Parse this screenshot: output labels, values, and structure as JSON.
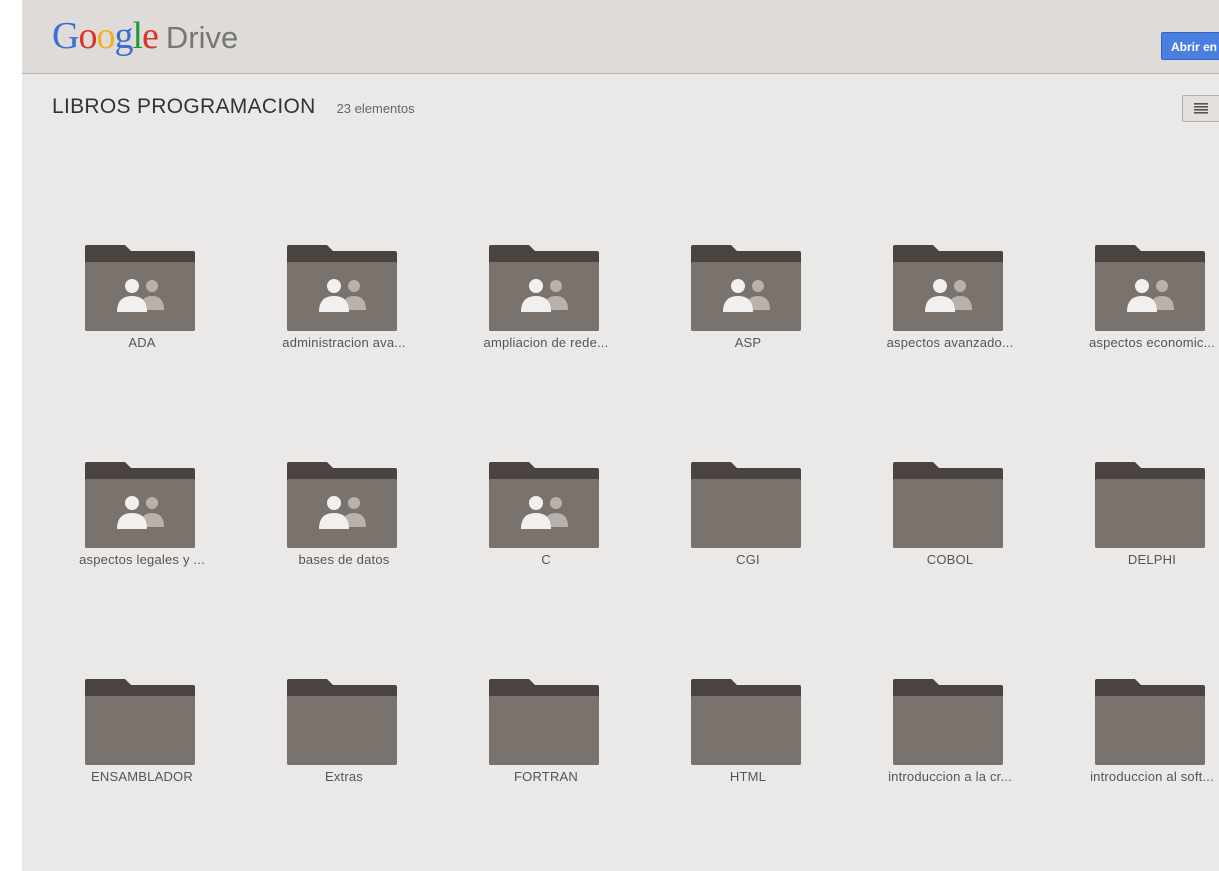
{
  "header": {
    "logo_google": "Google",
    "logo_drive": "Drive",
    "open_button_label": "Abrir en"
  },
  "folder": {
    "title": "LIBROS PROGRAMACION",
    "item_count": "23 elementos"
  },
  "icons": {
    "shared_folder": "shared-folder-icon",
    "plain_folder": "folder-icon",
    "list_view": "list-view-icon"
  },
  "colors": {
    "folder_fill": "#7a726d",
    "folder_tab": "#4b4340",
    "button_blue": "#4a7fe0"
  },
  "items": [
    {
      "name": "ADA",
      "shared": true
    },
    {
      "name": "administracion ava...",
      "shared": true
    },
    {
      "name": "ampliacion de rede...",
      "shared": true
    },
    {
      "name": "ASP",
      "shared": true
    },
    {
      "name": "aspectos avanzado...",
      "shared": true
    },
    {
      "name": "aspectos economic...",
      "shared": true
    },
    {
      "name": "aspectos legales y ...",
      "shared": true
    },
    {
      "name": "bases de datos",
      "shared": true
    },
    {
      "name": "C",
      "shared": true
    },
    {
      "name": "CGI",
      "shared": false
    },
    {
      "name": "COBOL",
      "shared": false
    },
    {
      "name": "DELPHI",
      "shared": false
    },
    {
      "name": "ENSAMBLADOR",
      "shared": false
    },
    {
      "name": "Extras",
      "shared": false
    },
    {
      "name": "FORTRAN",
      "shared": false
    },
    {
      "name": "HTML",
      "shared": false
    },
    {
      "name": "introduccion a la cr...",
      "shared": false
    },
    {
      "name": "introduccion al soft...",
      "shared": false
    }
  ]
}
